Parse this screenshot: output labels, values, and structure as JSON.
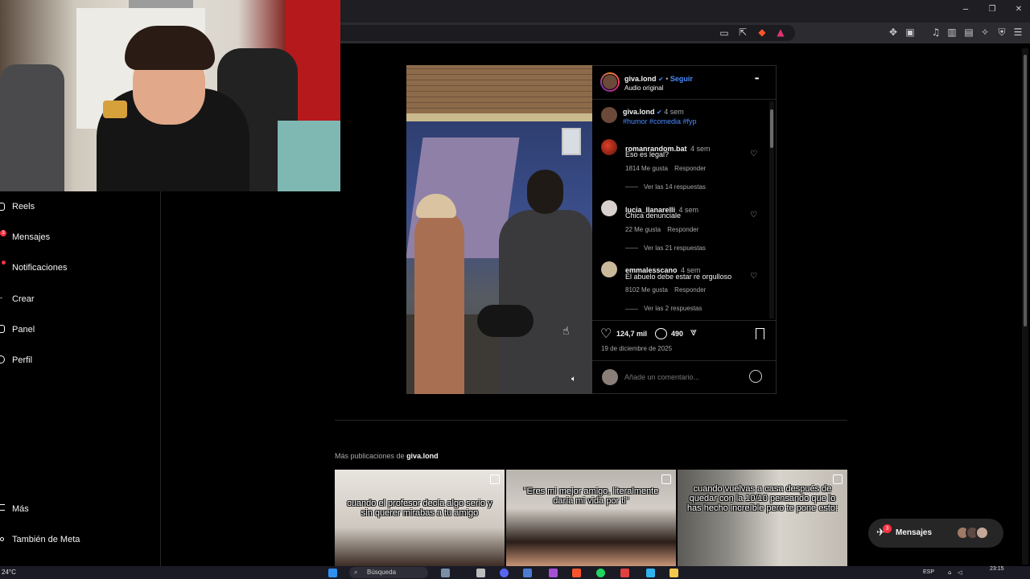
{
  "browser": {
    "window_controls": {
      "minimize": "─",
      "restore": "❐",
      "close": "✕"
    }
  },
  "sidebar": {
    "items": [
      {
        "label": "Reels",
        "icon": "reels-icon"
      },
      {
        "label": "Mensajes",
        "icon": "messages-icon",
        "badge": "3"
      },
      {
        "label": "Notificaciones",
        "icon": "heart-icon",
        "badge": ""
      },
      {
        "label": "Crear",
        "icon": "plus-icon"
      },
      {
        "label": "Panel",
        "icon": "panel-icon"
      },
      {
        "label": "Perfil",
        "icon": "profile-icon"
      }
    ],
    "bottom_items": [
      {
        "label": "Más",
        "icon": "menu-icon"
      },
      {
        "label": "También de Meta",
        "icon": "meta-icon"
      }
    ]
  },
  "post": {
    "header": {
      "username": "giva.lond",
      "separator": "•",
      "follow_label": "Seguir",
      "audio": "Audio original",
      "more": "•••"
    },
    "caption": {
      "username": "giva.lond",
      "time": "4 sem",
      "text": "#humor #comedia #fyp"
    },
    "comments": [
      {
        "username": "romanrandom.bat",
        "time": "4 sem",
        "text": "Eso es legal?",
        "likes": "1814 Me gusta",
        "reply": "Responder",
        "view_replies": "Ver las 14 respuestas"
      },
      {
        "username": "lucia_llanarelli",
        "time": "4 sem",
        "text": "Chica denunciale",
        "likes": "22 Me gusta",
        "reply": "Responder",
        "view_replies": "Ver las 21 respuestas"
      },
      {
        "username": "emmalesscano",
        "time": "4 sem",
        "text": "El abuelo debe estar re orgulloso",
        "likes": "8102 Me gusta",
        "reply": "Responder",
        "view_replies": "Ver las 2 respuestas"
      }
    ],
    "actions": {
      "likes": "124,7 mil",
      "comments": "490",
      "date": "19 de diciembre de 2025"
    },
    "add_comment_placeholder": "Añade un comentario..."
  },
  "more_posts": {
    "prefix": "Más publicaciones de ",
    "username": "giva.lond",
    "thumbnails": [
      {
        "caption": "cuando el profesor decía  algo serio y sin querer mirabas a tu amigo"
      },
      {
        "caption": "\"Eres mi mejor amigo, literalmente daría mi vida por ti\""
      },
      {
        "caption": "cuando vuelvas a casa después de quedar con la 10/10 pensando que lo has hecho increíble pero te pone esto:"
      }
    ]
  },
  "messages_pill": {
    "label": "Mensajes",
    "badge": "3"
  },
  "taskbar": {
    "weather": "24°C",
    "search": "Búsqueda",
    "language": "ESP",
    "time": "23:15"
  },
  "colors": {
    "background": "#000000",
    "accent_blue": "#4a8cff",
    "badge_red": "#ff3040"
  }
}
